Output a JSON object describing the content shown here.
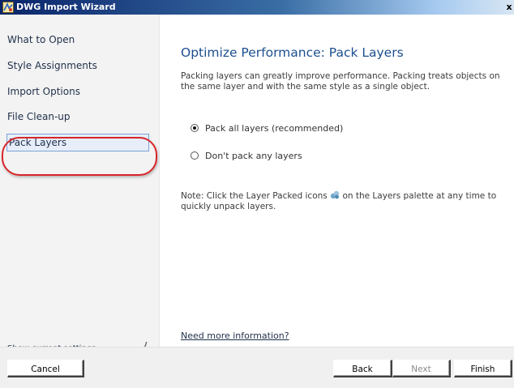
{
  "window": {
    "title": "DWG Import Wizard",
    "close_glyph": "x"
  },
  "sidebar": {
    "items": [
      {
        "label": "What to Open"
      },
      {
        "label": "Style Assignments"
      },
      {
        "label": "Import Options"
      },
      {
        "label": "File Clean-up"
      },
      {
        "label": "Pack Layers",
        "selected": true
      }
    ],
    "show_settings_label": "Show current settings",
    "highlight_color": "#d8262a"
  },
  "content": {
    "heading": "Optimize Performance: Pack Layers",
    "description": "Packing layers can greatly improve performance. Packing treats objects on the same layer and with the same style as a single object.",
    "options": [
      {
        "label": "Pack all layers (recommended)",
        "checked": true
      },
      {
        "label": "Don't pack any layers",
        "checked": false
      }
    ],
    "note_before_icon": "Note: Click the Layer Packed icons",
    "note_after_icon": "on the Layers palette at any time to quickly unpack layers.",
    "more_info_label": "Need more information?",
    "accent_color": "#1c4f8f"
  },
  "footer": {
    "cancel_label": "Cancel",
    "back_label": "Back",
    "next_label": "Next",
    "finish_label": "Finish"
  }
}
